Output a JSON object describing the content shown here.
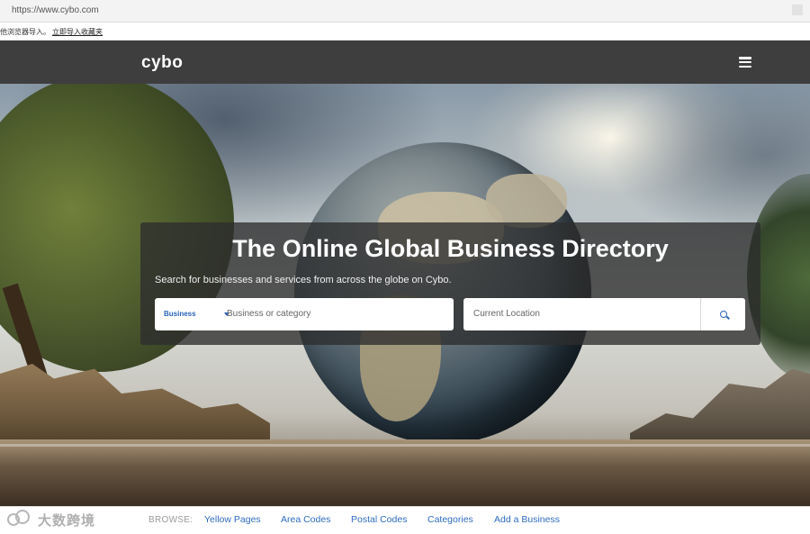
{
  "browser": {
    "url": "https://www.cybo.com",
    "notice_text": "他浏览器导入。",
    "notice_link": "立即导入收藏夹"
  },
  "header": {
    "logo": "cybo",
    "menu_icon": "hamburger-menu-icon"
  },
  "hero": {
    "title": "The Online Global Business Directory",
    "subtitle": "Search for businesses and services from across the globe on Cybo.",
    "business_select": "Business",
    "business_placeholder": "Business or category",
    "location_placeholder": "Current Location",
    "search_icon": "search-icon"
  },
  "browse": {
    "label": "BROWSE:",
    "links": [
      "Yellow Pages",
      "Area Codes",
      "Postal Codes",
      "Categories",
      "Add a Business"
    ]
  },
  "watermark": {
    "text": "大数跨境"
  },
  "colors": {
    "header_bg": "#3e3e3e",
    "link_blue": "#2f6cc0",
    "panel_bg": "rgba(45,45,45,0.78)"
  }
}
